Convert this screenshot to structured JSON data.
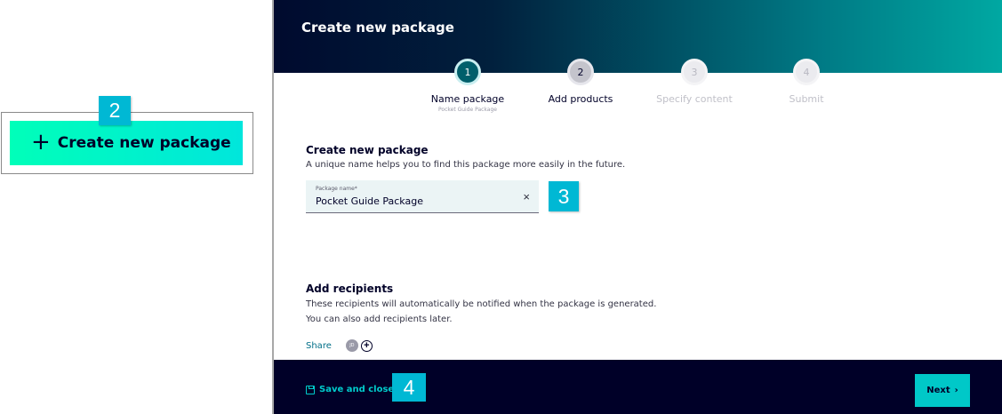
{
  "callouts": {
    "badge_2": "2",
    "badge_3": "3",
    "badge_4": "4"
  },
  "create_button": {
    "icon": "plus-icon",
    "plus_glyph": "+",
    "label": "Create new package"
  },
  "dialog": {
    "title": "Create new package",
    "stepper": [
      {
        "number": "1",
        "label": "Name package",
        "sublabel": "Pocket Guide Package",
        "state": "active"
      },
      {
        "number": "2",
        "label": "Add products",
        "state": "next"
      },
      {
        "number": "3",
        "label": "Specify content",
        "state": "disabled"
      },
      {
        "number": "4",
        "label": "Submit",
        "state": "disabled"
      }
    ],
    "name_section": {
      "title": "Create new package",
      "description": "A unique name helps you to find this package more easily in the future.",
      "input_label": "Package name*",
      "input_value": "Pocket Guide Package",
      "clear_icon": "close-icon",
      "clear_glyph": "×"
    },
    "recipients_section": {
      "title": "Add recipients",
      "description_line1": "These recipients will automatically be notified when the package is generated.",
      "description_line2": "You can also add recipients later.",
      "share_label": "Share",
      "avatar_initials": "JD",
      "add_icon": "add-circle-icon",
      "add_glyph": "+"
    },
    "footer": {
      "save_icon": "save-icon",
      "save_label": "Save and close",
      "next_label": "Next",
      "next_glyph": "›"
    }
  },
  "colors": {
    "accent_gradient_start": "#00ffb9",
    "accent_gradient_end": "#00e6dc",
    "badge": "#00b8d4",
    "footer_bg": "#000028",
    "next_button": "#00c8c8",
    "active_step": "#005f6b"
  }
}
